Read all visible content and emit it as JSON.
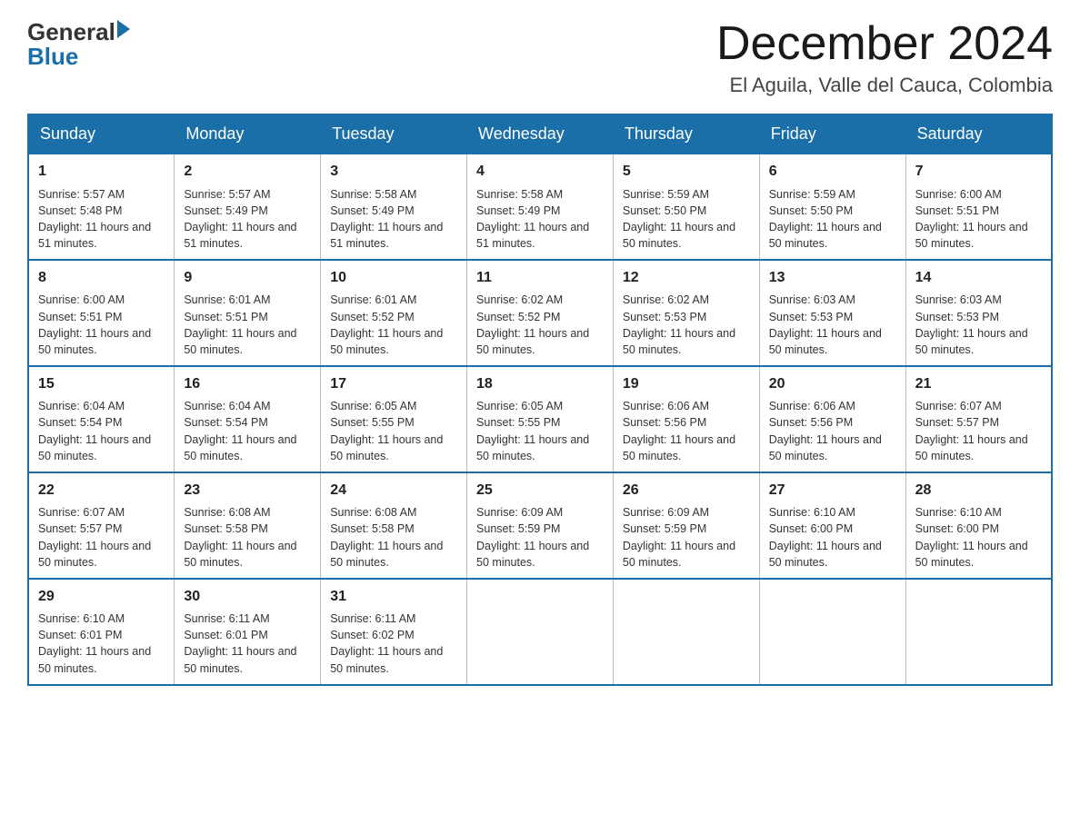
{
  "header": {
    "logo": {
      "general": "General",
      "blue": "Blue"
    },
    "title": "December 2024",
    "location": "El Aguila, Valle del Cauca, Colombia"
  },
  "days_of_week": [
    "Sunday",
    "Monday",
    "Tuesday",
    "Wednesday",
    "Thursday",
    "Friday",
    "Saturday"
  ],
  "weeks": [
    [
      {
        "day": "1",
        "sunrise": "5:57 AM",
        "sunset": "5:48 PM",
        "daylight": "11 hours and 51 minutes."
      },
      {
        "day": "2",
        "sunrise": "5:57 AM",
        "sunset": "5:49 PM",
        "daylight": "11 hours and 51 minutes."
      },
      {
        "day": "3",
        "sunrise": "5:58 AM",
        "sunset": "5:49 PM",
        "daylight": "11 hours and 51 minutes."
      },
      {
        "day": "4",
        "sunrise": "5:58 AM",
        "sunset": "5:49 PM",
        "daylight": "11 hours and 51 minutes."
      },
      {
        "day": "5",
        "sunrise": "5:59 AM",
        "sunset": "5:50 PM",
        "daylight": "11 hours and 50 minutes."
      },
      {
        "day": "6",
        "sunrise": "5:59 AM",
        "sunset": "5:50 PM",
        "daylight": "11 hours and 50 minutes."
      },
      {
        "day": "7",
        "sunrise": "6:00 AM",
        "sunset": "5:51 PM",
        "daylight": "11 hours and 50 minutes."
      }
    ],
    [
      {
        "day": "8",
        "sunrise": "6:00 AM",
        "sunset": "5:51 PM",
        "daylight": "11 hours and 50 minutes."
      },
      {
        "day": "9",
        "sunrise": "6:01 AM",
        "sunset": "5:51 PM",
        "daylight": "11 hours and 50 minutes."
      },
      {
        "day": "10",
        "sunrise": "6:01 AM",
        "sunset": "5:52 PM",
        "daylight": "11 hours and 50 minutes."
      },
      {
        "day": "11",
        "sunrise": "6:02 AM",
        "sunset": "5:52 PM",
        "daylight": "11 hours and 50 minutes."
      },
      {
        "day": "12",
        "sunrise": "6:02 AM",
        "sunset": "5:53 PM",
        "daylight": "11 hours and 50 minutes."
      },
      {
        "day": "13",
        "sunrise": "6:03 AM",
        "sunset": "5:53 PM",
        "daylight": "11 hours and 50 minutes."
      },
      {
        "day": "14",
        "sunrise": "6:03 AM",
        "sunset": "5:53 PM",
        "daylight": "11 hours and 50 minutes."
      }
    ],
    [
      {
        "day": "15",
        "sunrise": "6:04 AM",
        "sunset": "5:54 PM",
        "daylight": "11 hours and 50 minutes."
      },
      {
        "day": "16",
        "sunrise": "6:04 AM",
        "sunset": "5:54 PM",
        "daylight": "11 hours and 50 minutes."
      },
      {
        "day": "17",
        "sunrise": "6:05 AM",
        "sunset": "5:55 PM",
        "daylight": "11 hours and 50 minutes."
      },
      {
        "day": "18",
        "sunrise": "6:05 AM",
        "sunset": "5:55 PM",
        "daylight": "11 hours and 50 minutes."
      },
      {
        "day": "19",
        "sunrise": "6:06 AM",
        "sunset": "5:56 PM",
        "daylight": "11 hours and 50 minutes."
      },
      {
        "day": "20",
        "sunrise": "6:06 AM",
        "sunset": "5:56 PM",
        "daylight": "11 hours and 50 minutes."
      },
      {
        "day": "21",
        "sunrise": "6:07 AM",
        "sunset": "5:57 PM",
        "daylight": "11 hours and 50 minutes."
      }
    ],
    [
      {
        "day": "22",
        "sunrise": "6:07 AM",
        "sunset": "5:57 PM",
        "daylight": "11 hours and 50 minutes."
      },
      {
        "day": "23",
        "sunrise": "6:08 AM",
        "sunset": "5:58 PM",
        "daylight": "11 hours and 50 minutes."
      },
      {
        "day": "24",
        "sunrise": "6:08 AM",
        "sunset": "5:58 PM",
        "daylight": "11 hours and 50 minutes."
      },
      {
        "day": "25",
        "sunrise": "6:09 AM",
        "sunset": "5:59 PM",
        "daylight": "11 hours and 50 minutes."
      },
      {
        "day": "26",
        "sunrise": "6:09 AM",
        "sunset": "5:59 PM",
        "daylight": "11 hours and 50 minutes."
      },
      {
        "day": "27",
        "sunrise": "6:10 AM",
        "sunset": "6:00 PM",
        "daylight": "11 hours and 50 minutes."
      },
      {
        "day": "28",
        "sunrise": "6:10 AM",
        "sunset": "6:00 PM",
        "daylight": "11 hours and 50 minutes."
      }
    ],
    [
      {
        "day": "29",
        "sunrise": "6:10 AM",
        "sunset": "6:01 PM",
        "daylight": "11 hours and 50 minutes."
      },
      {
        "day": "30",
        "sunrise": "6:11 AM",
        "sunset": "6:01 PM",
        "daylight": "11 hours and 50 minutes."
      },
      {
        "day": "31",
        "sunrise": "6:11 AM",
        "sunset": "6:02 PM",
        "daylight": "11 hours and 50 minutes."
      },
      null,
      null,
      null,
      null
    ]
  ],
  "labels": {
    "sunrise_prefix": "Sunrise: ",
    "sunset_prefix": "Sunset: ",
    "daylight_prefix": "Daylight: "
  }
}
